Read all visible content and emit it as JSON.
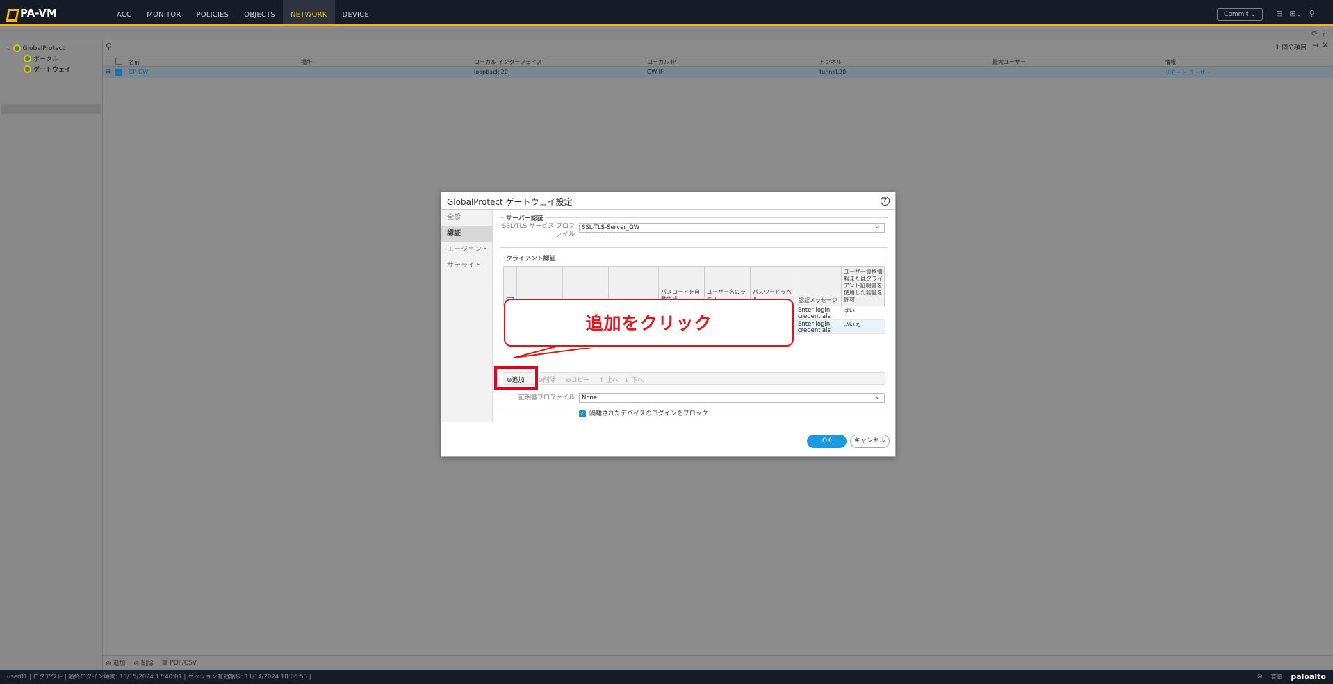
{
  "app": {
    "logo": "PA-VM"
  },
  "nav": {
    "tabs": [
      "ACC",
      "MONITOR",
      "POLICIES",
      "OBJECTS",
      "NETWORK",
      "DEVICE"
    ],
    "active": "NETWORK"
  },
  "header": {
    "commit_label": "Commit ⌄"
  },
  "tree": {
    "root": "GlobalProtect",
    "items": [
      "ポータル",
      "ゲートウェイ"
    ],
    "selected": "ゲートウェイ"
  },
  "table": {
    "count": "1 個の項目",
    "columns": [
      "名前",
      "場所",
      "ローカル インターフェイス",
      "ローカル IP",
      "トンネル",
      "最大ユーザー",
      "情報"
    ],
    "rows": [
      {
        "name": "GP-GW",
        "location": "",
        "interface": "loopback.20",
        "ip": "GW-IF",
        "tunnel": "tunnel.20",
        "max_users": "",
        "info": "リモート ユーザー"
      }
    ]
  },
  "bottom": {
    "add": "追加",
    "delete": "削除",
    "pdf": "PDF/CSV"
  },
  "status": {
    "text": "user01 | ログアウト | 最終ログイン時間: 10/15/2024 17:40:01 | セッション有効期限: 11/14/2024 18:06:53 |",
    "lang": "言語",
    "brand": "paloalto"
  },
  "dialog": {
    "title": "GlobalProtect ゲートウェイ設定",
    "tabs": [
      "全般",
      "認証",
      "エージェント",
      "サテライト"
    ],
    "active_tab": "認証",
    "server_auth": {
      "legend": "サーバー認証",
      "label": "SSL/TLS サービス プロファイル",
      "value": "SSL-TLS-Server_GW"
    },
    "client_auth": {
      "legend": "クライアント認証",
      "columns": [
        "名前",
        "OS",
        "認証プロファイル",
        "パスコードを自動生成",
        "ユーザー名のラベル",
        "パスワードラベル",
        "認証メッセージ",
        "ユーザー資格情報またはクライアント証明書を使用した認証を許可"
      ],
      "rows": [
        {
          "message": "Enter login credentials",
          "allow": "はい"
        },
        {
          "message": "Enter login credentials",
          "allow": "いいえ"
        }
      ]
    },
    "toolbar": {
      "add": "追加",
      "delete": "削除",
      "copy": "コピー",
      "up": "上へ",
      "down": "下へ"
    },
    "cert_label": "証明書プロファイル",
    "cert_value": "None",
    "block_label": "隔離されたデバイスのログインをブロック",
    "ok": "OK",
    "cancel": "キャンセル"
  },
  "annotation": {
    "callout": "追加をクリック"
  }
}
